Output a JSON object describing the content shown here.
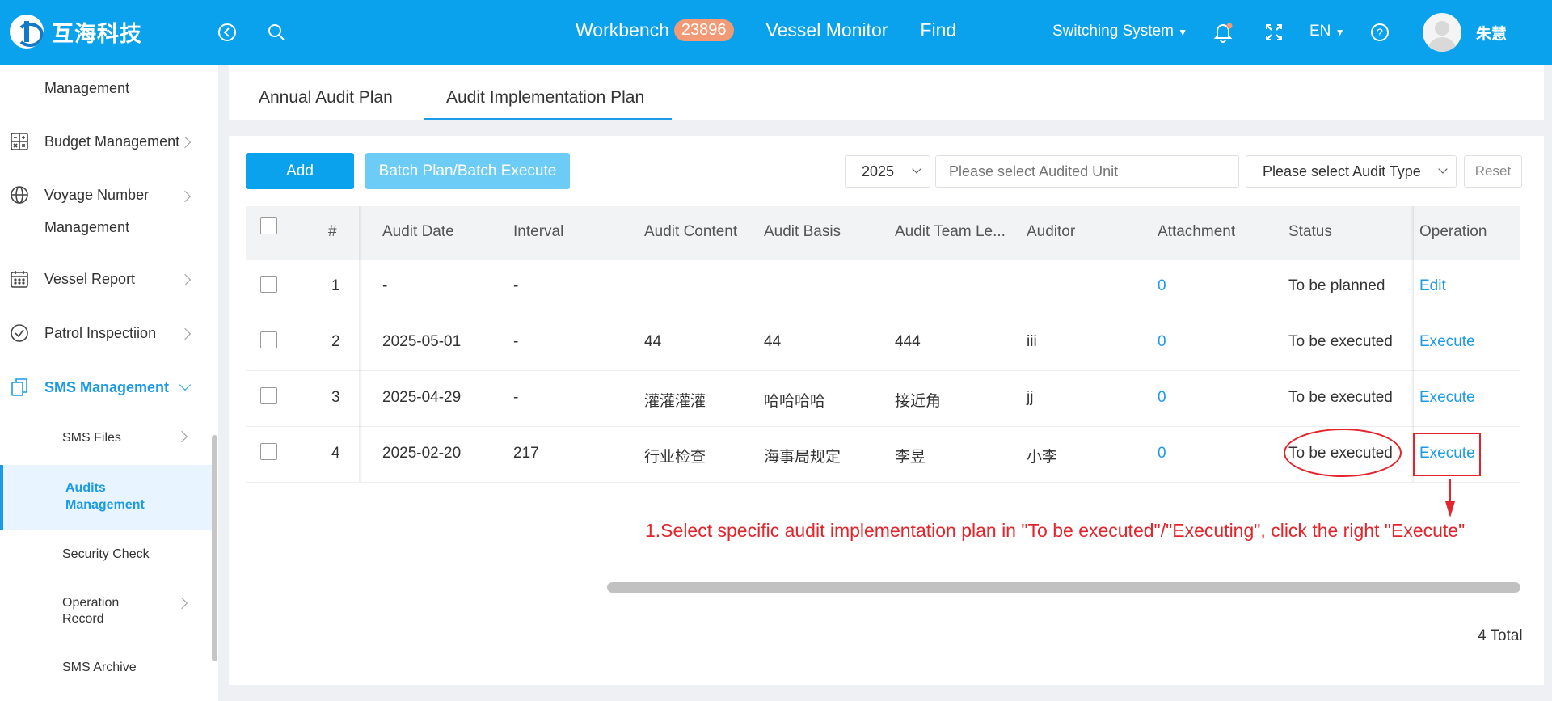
{
  "header": {
    "logo_text": "互海科技",
    "nav": {
      "workbench": "Workbench",
      "workbench_badge": "23896",
      "vessel_monitor": "Vessel Monitor",
      "find": "Find"
    },
    "switching_system": "Switching System",
    "language": "EN",
    "username": "朱慧",
    "colors": {
      "bar": "#0aa2ec",
      "badge": "#f29a76"
    }
  },
  "sidebar": {
    "items": [
      {
        "label_line2": "Management"
      },
      {
        "label": "Budget Management"
      },
      {
        "label": "Voyage Number",
        "label_line2": "Management"
      },
      {
        "label": "Vessel Report"
      },
      {
        "label": "Patrol Inspectiion"
      },
      {
        "label": "SMS Management"
      }
    ],
    "sub_items": [
      {
        "label": "SMS Files"
      },
      {
        "label": "Audits",
        "label_line2": "Management"
      },
      {
        "label": "Security Check"
      },
      {
        "label": "Operation",
        "label_line2": "Record"
      },
      {
        "label": "SMS Archive"
      }
    ]
  },
  "tabs": {
    "annual": "Annual Audit Plan",
    "implementation": "Audit Implementation Plan"
  },
  "toolbar": {
    "add": "Add",
    "batch": "Batch Plan/Batch Execute",
    "year": "2025",
    "unit_placeholder": "Please select Audited Unit",
    "audit_type": "Please select Audit Type",
    "reset": "Reset"
  },
  "table": {
    "headers": {
      "index": "#",
      "audit_date": "Audit Date",
      "interval": "Interval",
      "audit_content": "Audit Content",
      "audit_basis": "Audit Basis",
      "team_leader": "Audit Team Le...",
      "auditor": "Auditor",
      "attachment": "Attachment",
      "status": "Status",
      "operation": "Operation"
    },
    "rows": [
      {
        "index": "1",
        "audit_date": "-",
        "interval": "-",
        "audit_content": "",
        "audit_basis": "",
        "team_leader": "",
        "auditor": "",
        "attachment": "0",
        "status": "To be planned",
        "operation": "Edit"
      },
      {
        "index": "2",
        "audit_date": "2025-05-01",
        "interval": "-",
        "audit_content": "44",
        "audit_basis": "44",
        "team_leader": "444",
        "auditor": "iii",
        "attachment": "0",
        "status": "To be executed",
        "operation": "Execute"
      },
      {
        "index": "3",
        "audit_date": "2025-04-29",
        "interval": "-",
        "audit_content": "灌灌灌灌",
        "audit_basis": "哈哈哈哈",
        "team_leader": "接近角",
        "auditor": "jj",
        "attachment": "0",
        "status": "To be executed",
        "operation": "Execute"
      },
      {
        "index": "4",
        "audit_date": "2025-02-20",
        "interval": "217",
        "audit_content": "行业检查",
        "audit_basis": "海事局规定",
        "team_leader": "李昱",
        "auditor": "小李",
        "attachment": "0",
        "status": "To be executed",
        "operation": "Execute"
      }
    ]
  },
  "total": "4 Total",
  "annotation": "1.Select specific audit implementation plan in \"To be executed\"/\"Executing\", click the right \"Execute\""
}
